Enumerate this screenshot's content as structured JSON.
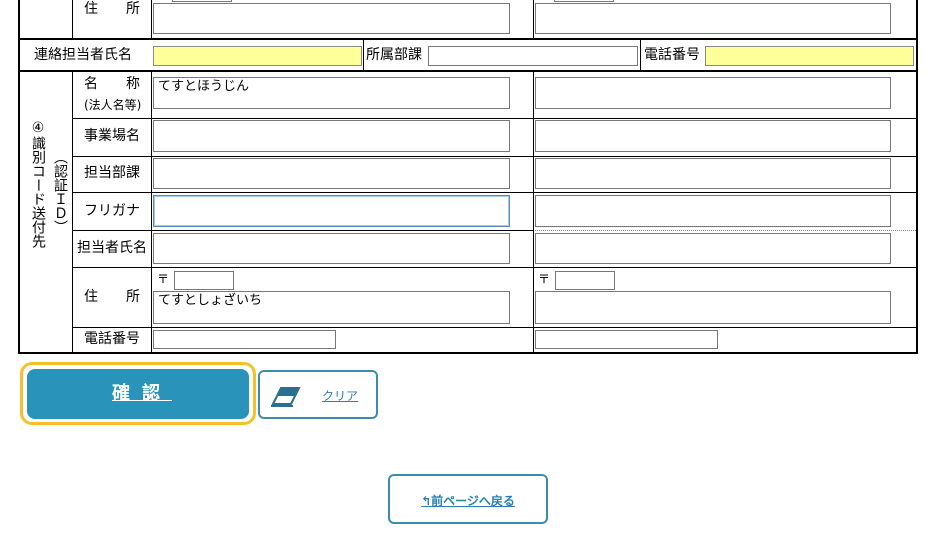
{
  "top_section": {
    "address_label": "住　　所"
  },
  "contact_row": {
    "contact_person_label": "連絡担当者氏名",
    "department_label": "所属部課",
    "phone_label": "電話番号"
  },
  "section4": {
    "title": "④識別コード送付先",
    "subtitle": "（認証ＩＤ）",
    "name_label": "名　　称",
    "name_sublabel": "(法人名等)",
    "name_value": "てすとほうじん",
    "office_label": "事業場名",
    "dept_label": "担当部課",
    "furigana_label": "フリガナ",
    "person_label": "担当者氏名",
    "address_label": "住　　所",
    "postal_mark": "〒",
    "address_value": "てすとしょざいち",
    "phone_label": "電話番号"
  },
  "buttons": {
    "confirm": "確認",
    "clear": "クリア",
    "back": "前ページへ戻る",
    "back_arrow": "↰"
  }
}
